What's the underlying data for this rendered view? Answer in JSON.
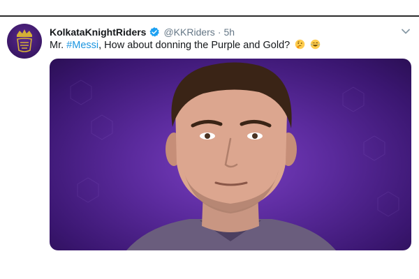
{
  "tweet": {
    "display_name": "KolkataKnightRiders",
    "handle": "@KKRiders",
    "separator": "·",
    "time": "5h",
    "text_prefix": "Mr. ",
    "hashtag": "#Messi",
    "text_suffix": ", How about donning the Purple and Gold?",
    "emojis": [
      "thinking-face",
      "face-with-tears-of-joy"
    ]
  },
  "colors": {
    "hashtag": "#1b95e0",
    "verified": "#1da1f2",
    "muted": "#657786",
    "brand_purple": "#3a1766",
    "brand_gold": "#d4af37"
  },
  "icons": {
    "verified": "verified-badge-icon",
    "more": "chevron-down-icon"
  }
}
